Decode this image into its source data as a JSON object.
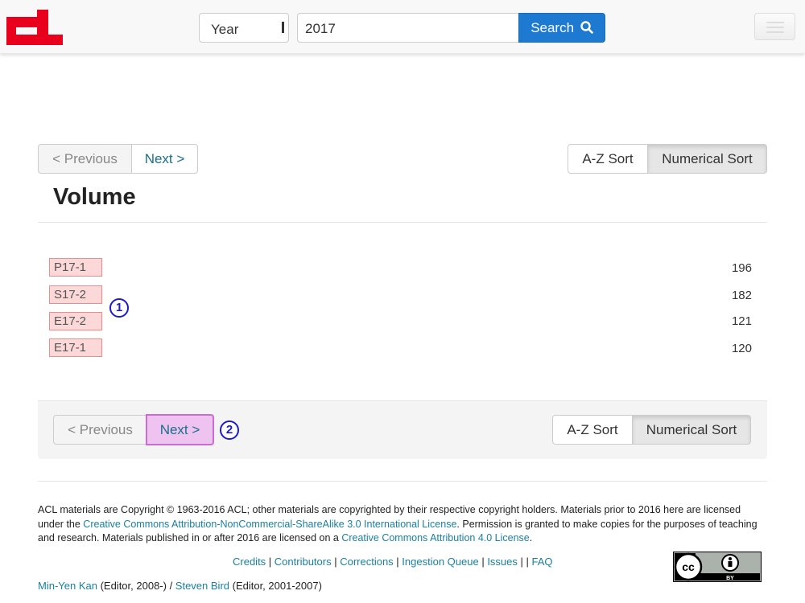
{
  "navbar": {
    "year_select": "Year",
    "search_value": "2017",
    "search_button": "Search"
  },
  "pager_top": {
    "previous": "< Previous",
    "next": "Next >",
    "az_sort": "A-Z Sort",
    "numerical_sort": "Numerical Sort"
  },
  "title": "Volume",
  "volumes": [
    {
      "id": "P17-1",
      "count": "196"
    },
    {
      "id": "S17-2",
      "count": "182"
    },
    {
      "id": "E17-2",
      "count": "121"
    },
    {
      "id": "E17-1",
      "count": "120"
    }
  ],
  "markers": {
    "one": "1",
    "two": "2"
  },
  "pager_bottom": {
    "previous": "< Previous",
    "next": "Next >",
    "az_sort": "A-Z Sort",
    "numerical_sort": "Numerical Sort"
  },
  "footer": {
    "text_1": "ACL materials are Copyright © 1963-2016 ACL; other materials are copyrighted by their respective copyright holders. Materials prior to 2016 here are licensed under the ",
    "link_1": "Creative Commons Attribution-NonCommercial-ShareAlike 3.0 International License",
    "text_2": ". Permission is granted to make copies for the purposes of teaching and research. Materials published in or after 2016 are licensed on a ",
    "link_2": "Creative Commons Attribution 4.0 License",
    "text_3": ".",
    "links": [
      "Credits",
      "Contributors",
      "Corrections",
      "Ingestion Queue",
      "Issues",
      "FAQ"
    ],
    "sep": " | ",
    "empty_sep": " | | ",
    "editor_1": "Min-Yen Kan",
    "editor_1_role": " (Editor, 2008-) / ",
    "editor_2": "Steven Bird",
    "editor_2_role": " (Editor, 2001-2007)"
  },
  "cc_badge": {
    "cc": "cc",
    "by": "BY"
  },
  "colors": {
    "accent": "#1e7ad1",
    "logo": "#e8001c",
    "tag_bg": "#fcd8d8",
    "highlight": "#efc3f0"
  }
}
